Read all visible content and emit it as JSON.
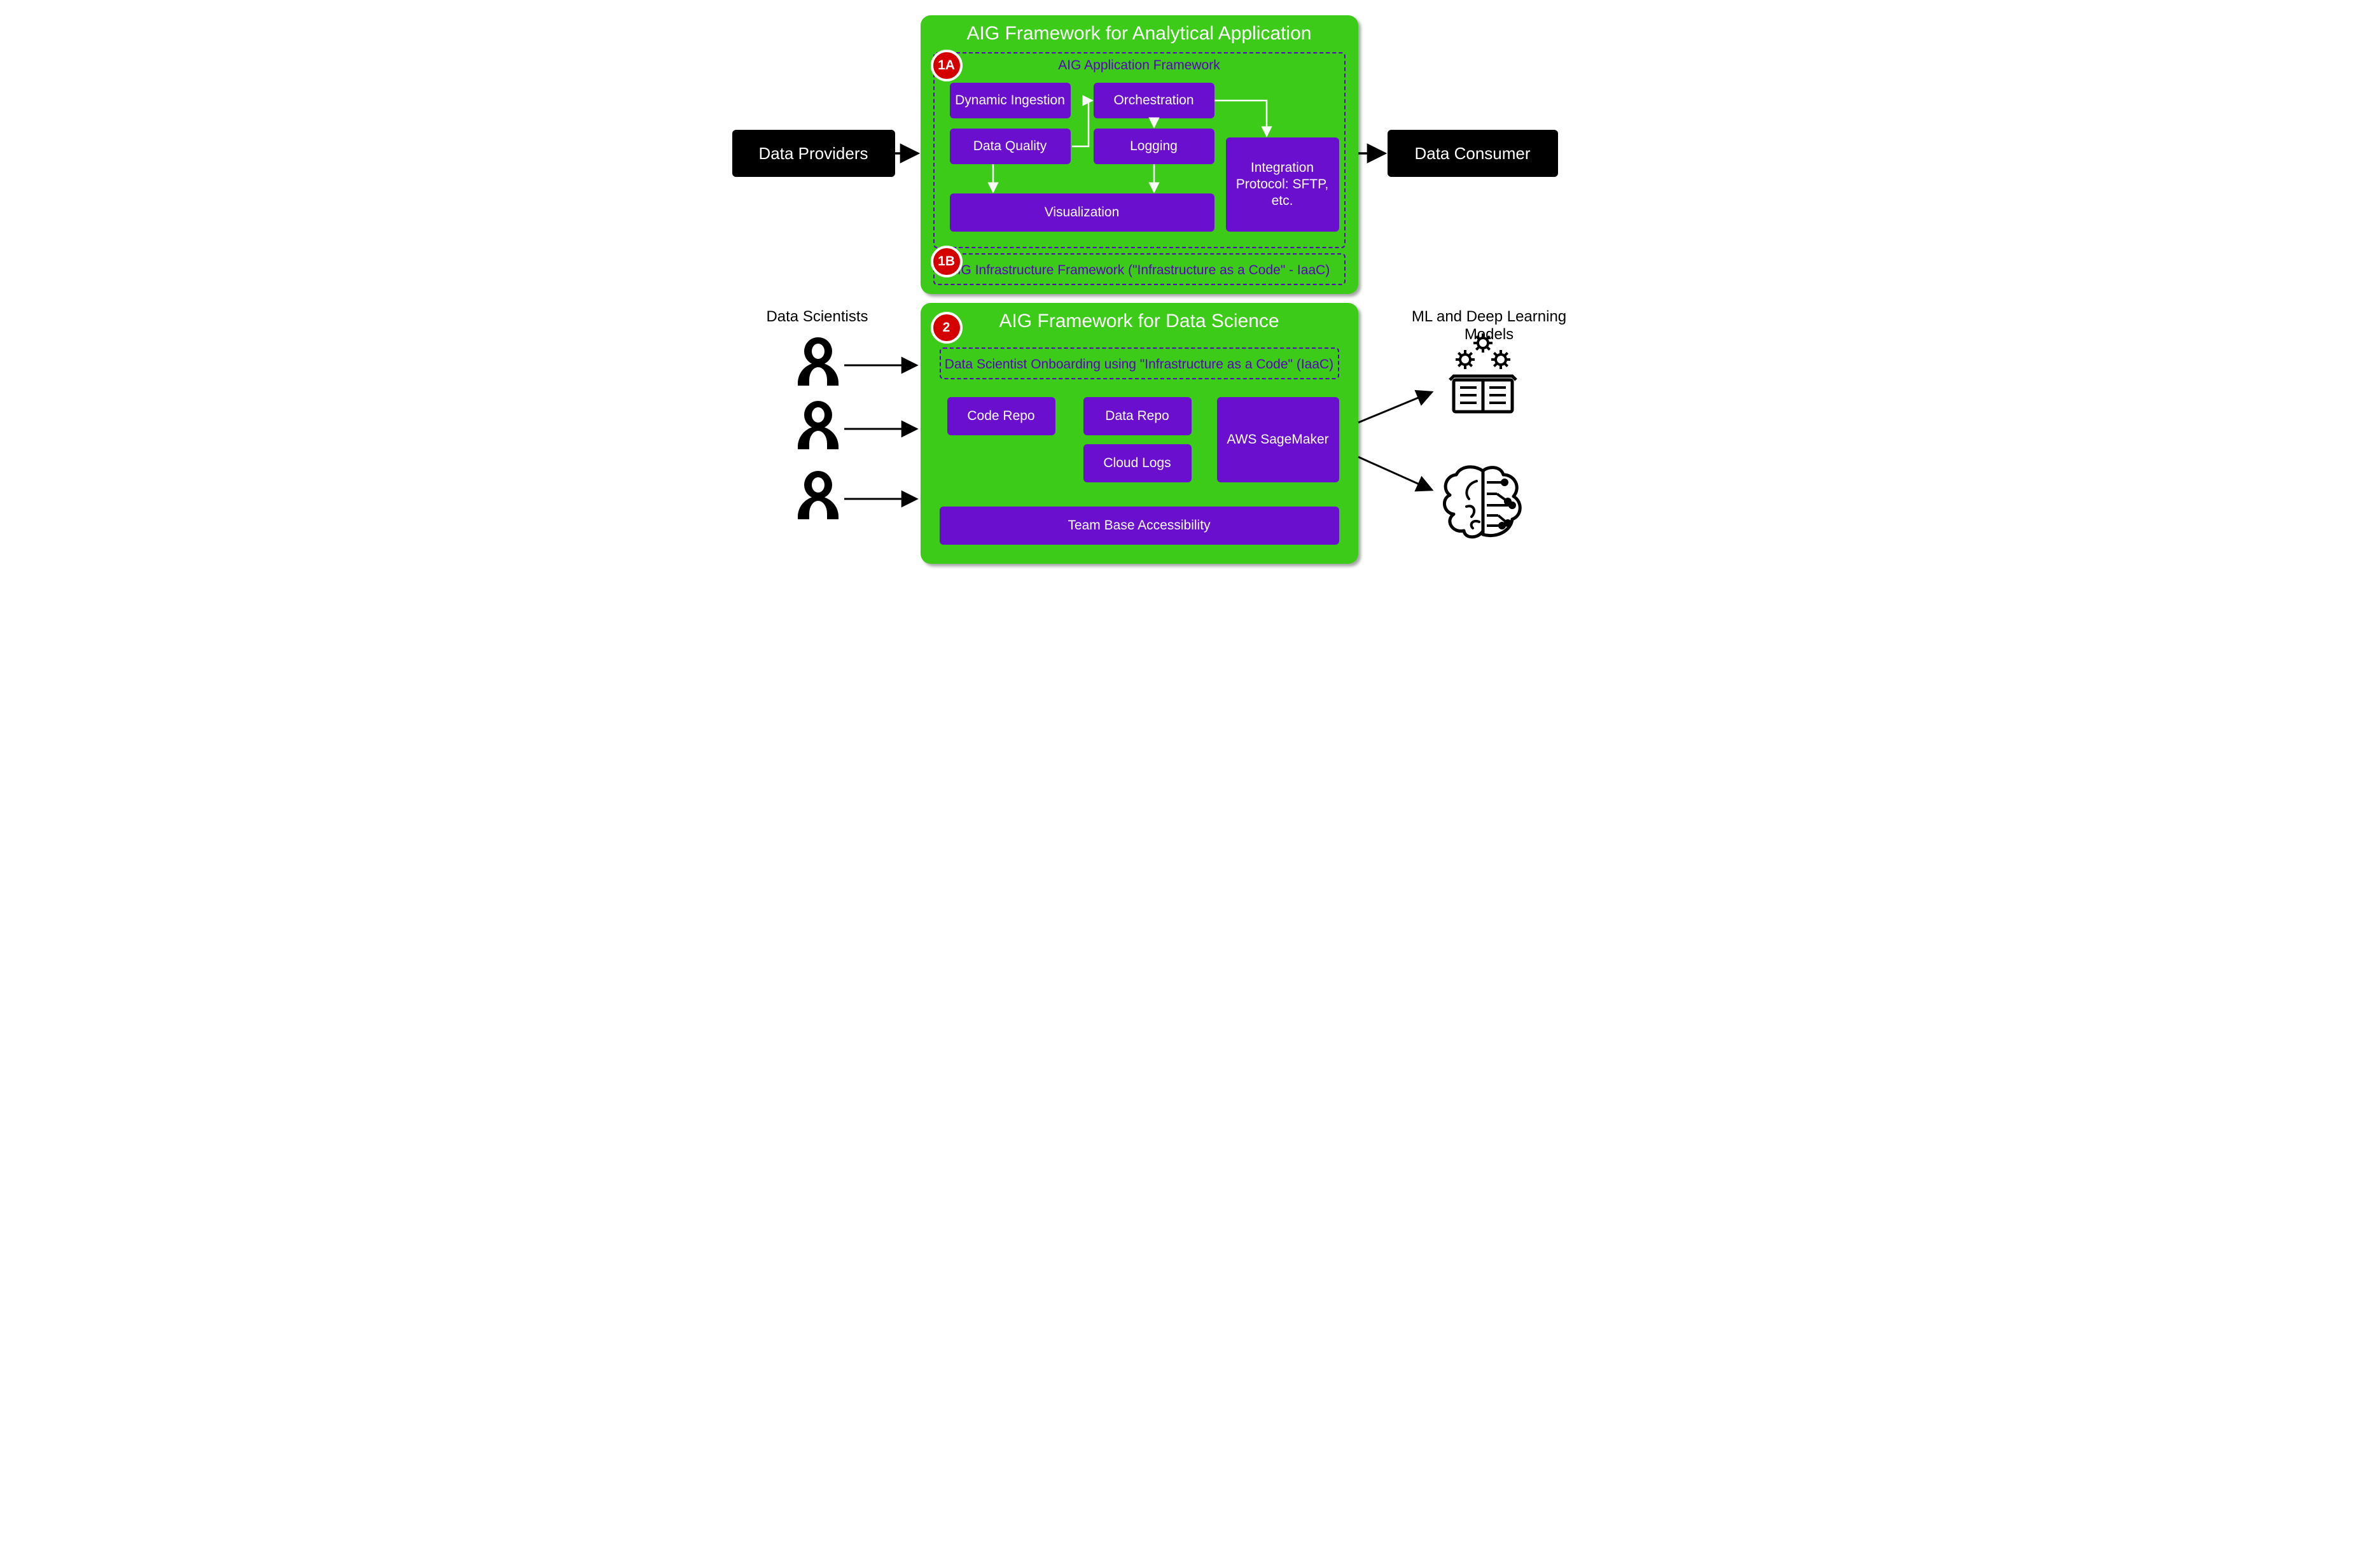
{
  "left": {
    "data_providers": "Data Providers",
    "scientists_label": "Data Scientists"
  },
  "right": {
    "data_consumer": "Data Consumer",
    "models_label": "ML and Deep Learning Models"
  },
  "panel_top": {
    "title": "AIG Framework for Analytical Application",
    "badge_1a": "1A",
    "frame_1a_label": "AIG Application Framework",
    "dynamic_ingestion": "Dynamic Ingestion",
    "data_quality": "Data Quality",
    "orchestration": "Orchestration",
    "logging": "Logging",
    "visualization": "Visualization",
    "integration": "Integration Protocol: SFTP, etc.",
    "badge_1b": "1B",
    "frame_1b_label": "AIG Infrastructure Framework  (\"Infrastructure as a Code\" - IaaC)"
  },
  "panel_bottom": {
    "title": "AIG Framework for Data Science",
    "badge_2": "2",
    "onboarding": "Data Scientist Onboarding using \"Infrastructure as a Code\" (IaaC)",
    "code_repo": "Code Repo",
    "data_repo": "Data Repo",
    "cloud_logs": "Cloud Logs",
    "sagemaker": "AWS SageMaker",
    "team_base": "Team Base Accessibility"
  }
}
